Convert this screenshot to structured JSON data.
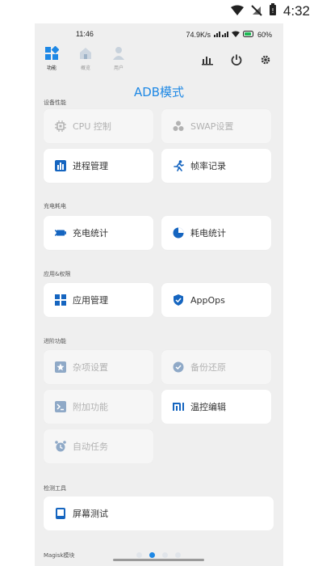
{
  "system": {
    "time": "4:32"
  },
  "inner": {
    "time": "11:46",
    "net": "74.9K/s",
    "battery": "60%"
  },
  "nav": {
    "tabs": [
      {
        "label": "功能",
        "active": true
      },
      {
        "label": "概览",
        "active": false
      },
      {
        "label": "用户",
        "active": false
      }
    ]
  },
  "page_title": "ADB模式",
  "sections": {
    "device": "设备性能",
    "charge": "充电耗电",
    "apps": "应用&权限",
    "advanced": "进阶功能",
    "test": "检测工具",
    "magisk": "Magisk模块"
  },
  "cards": {
    "cpu": "CPU 控制",
    "swap": "SWAP设置",
    "process": "进程管理",
    "fps": "帧率记录",
    "charge_stat": "充电统计",
    "power_stat": "耗电统计",
    "app_manage": "应用管理",
    "appops": "AppOps",
    "misc": "杂项设置",
    "backup": "备份还原",
    "addon": "附加功能",
    "thermal": "温控编辑",
    "auto_task": "自动任务",
    "screen_test": "屏幕测试"
  },
  "colors": {
    "accent": "#1e88e5",
    "bg": "#efefef",
    "card": "#ffffff",
    "disabled_text": "#b2b2b2"
  },
  "pager": {
    "count": 4,
    "active_index": 1
  }
}
